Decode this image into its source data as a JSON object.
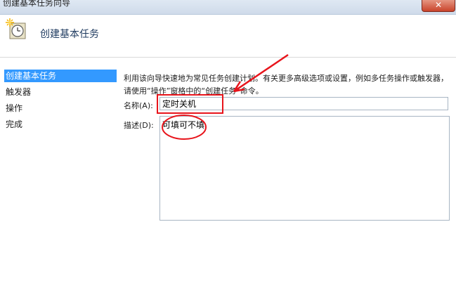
{
  "window": {
    "title": "创建基本任务向导",
    "close_glyph": "✕"
  },
  "header": {
    "title": "创建基本任务",
    "icon": "task-clock-icon"
  },
  "nav": {
    "items": [
      {
        "label": "创建基本任务",
        "active": true
      },
      {
        "label": "触发器",
        "active": false
      },
      {
        "label": "操作",
        "active": false
      },
      {
        "label": "完成",
        "active": false
      }
    ]
  },
  "content": {
    "description": "利用该向导快速地为常见任务创建计划。有关更多高级选项或设置，例如多任务操作或触发器，请使用“操作”窗格中的“创建任务”命令。",
    "name_label": "名称(A):",
    "name_value": "定时关机",
    "desc_label": "描述(D):",
    "desc_value": "可填可不填"
  },
  "colors": {
    "annotation_red": "#e8141b",
    "nav_active": "#3399ff"
  }
}
